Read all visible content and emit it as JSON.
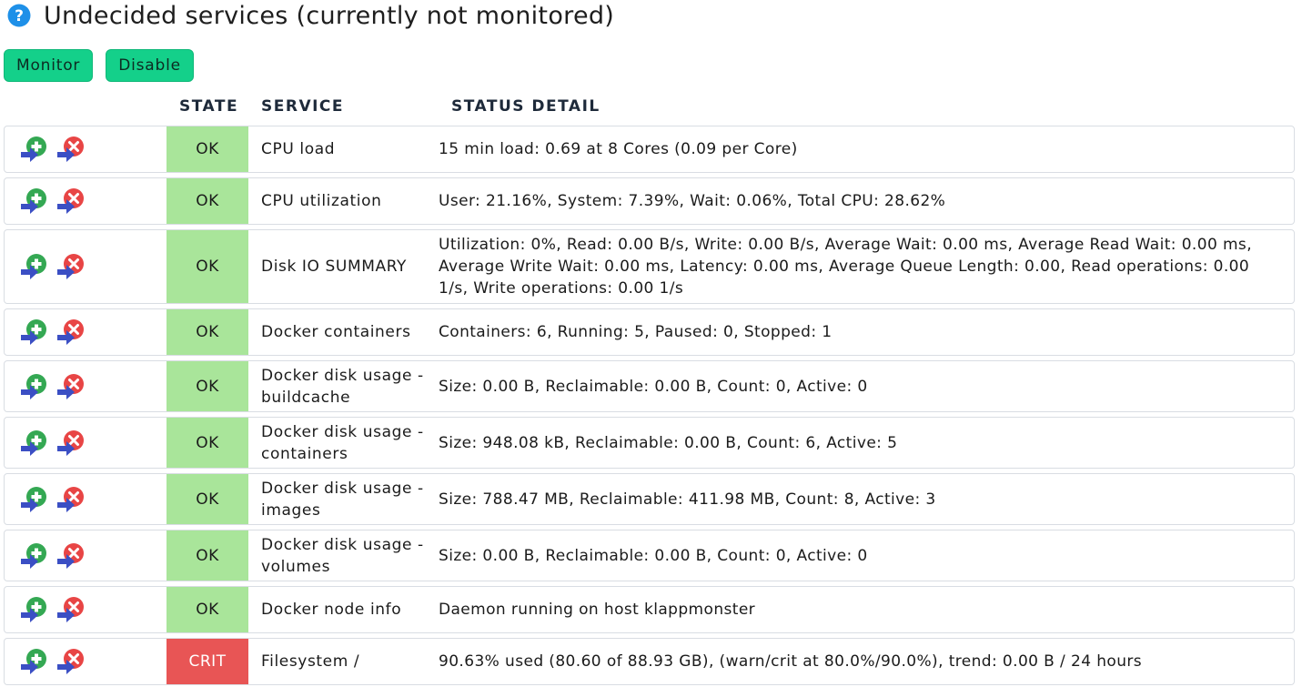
{
  "page": {
    "title": "Undecided services (currently not monitored)",
    "help_icon": "help-icon"
  },
  "buttons": {
    "monitor_label": "Monitor",
    "disable_label": "Disable"
  },
  "columns": {
    "state": "STATE",
    "service": "SERVICE",
    "status_detail": "STATUS DETAIL"
  },
  "colors": {
    "ok": "#a9e59a",
    "crit": "#e85555",
    "button": "#14d08a"
  },
  "rows": [
    {
      "state": "OK",
      "service": "CPU load",
      "detail": "15 min load: 0.69 at 8 Cores (0.09 per Core)"
    },
    {
      "state": "OK",
      "service": "CPU utilization",
      "detail": "User: 21.16%, System: 7.39%, Wait: 0.06%, Total CPU: 28.62%"
    },
    {
      "state": "OK",
      "service": "Disk IO SUMMARY",
      "detail": "Utilization: 0%, Read: 0.00 B/s, Write: 0.00 B/s, Average Wait: 0.00 ms, Average Read Wait: 0.00 ms, Average Write Wait: 0.00 ms, Latency: 0.00 ms, Average Queue Length: 0.00, Read operations: 0.00 1/s, Write operations: 0.00 1/s"
    },
    {
      "state": "OK",
      "service": "Docker containers",
      "detail": "Containers: 6, Running: 5, Paused: 0, Stopped: 1"
    },
    {
      "state": "OK",
      "service": "Docker disk usage - buildcache",
      "detail": "Size: 0.00 B, Reclaimable: 0.00 B, Count: 0, Active: 0"
    },
    {
      "state": "OK",
      "service": "Docker disk usage - containers",
      "detail": "Size: 948.08 kB, Reclaimable: 0.00 B, Count: 6, Active: 5"
    },
    {
      "state": "OK",
      "service": "Docker disk usage - images",
      "detail": "Size: 788.47 MB, Reclaimable: 411.98 MB, Count: 8, Active: 3"
    },
    {
      "state": "OK",
      "service": "Docker disk usage - volumes",
      "detail": "Size: 0.00 B, Reclaimable: 0.00 B, Count: 0, Active: 0"
    },
    {
      "state": "OK",
      "service": "Docker node info",
      "detail": "Daemon running on host klappmonster"
    },
    {
      "state": "CRIT",
      "service": "Filesystem /",
      "detail": "90.63% used (80.60 of 88.93 GB), (warn/crit at 80.0%/90.0%), trend: 0.00 B / 24 hours"
    }
  ]
}
